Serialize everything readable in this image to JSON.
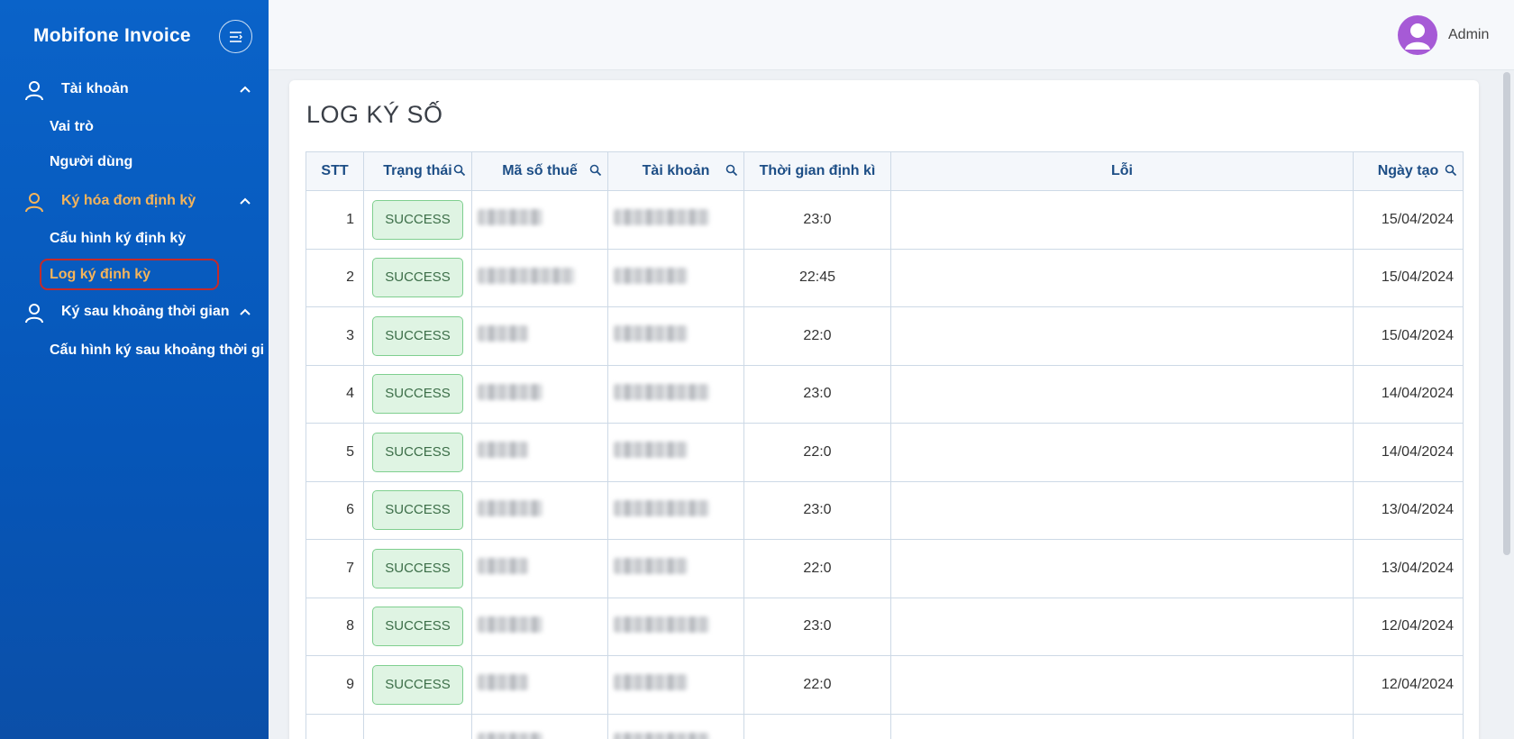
{
  "app": {
    "title": "Mobifone Invoice"
  },
  "user": {
    "name": "Admin"
  },
  "sidebar": {
    "groups": [
      {
        "label": "Tài khoản",
        "icon": "user-icon",
        "expanded": true,
        "items": [
          "Vai trò",
          "Người dùng"
        ]
      },
      {
        "label": "Ký hóa đơn định kỳ",
        "icon": "user-icon",
        "expanded": true,
        "active": true,
        "items": [
          "Cấu hình ký định kỳ",
          "Log ký định kỳ"
        ]
      },
      {
        "label": "Ký sau khoảng thời gian",
        "icon": "user-icon",
        "expanded": true,
        "items": [
          "Cấu hình ký sau khoảng thời gi"
        ]
      }
    ],
    "active_item": "Log ký định kỳ"
  },
  "main": {
    "title": "LOG KÝ SỐ",
    "columns": [
      {
        "label": "STT",
        "searchable": false
      },
      {
        "label": "Trạng thái",
        "searchable": true
      },
      {
        "label": "Mã số thuế",
        "searchable": true
      },
      {
        "label": "Tài khoản",
        "searchable": true
      },
      {
        "label": "Thời gian định kì",
        "searchable": false
      },
      {
        "label": "Lỗi",
        "searchable": false
      },
      {
        "label": "Ngày tạo",
        "searchable": true
      }
    ],
    "rows": [
      {
        "stt": "1",
        "status": "SUCCESS",
        "time": "23:0",
        "error": "",
        "date": "15/04/2024"
      },
      {
        "stt": "2",
        "status": "SUCCESS",
        "time": "22:45",
        "error": "",
        "date": "15/04/2024"
      },
      {
        "stt": "3",
        "status": "SUCCESS",
        "time": "22:0",
        "error": "",
        "date": "15/04/2024"
      },
      {
        "stt": "4",
        "status": "SUCCESS",
        "time": "23:0",
        "error": "",
        "date": "14/04/2024"
      },
      {
        "stt": "5",
        "status": "SUCCESS",
        "time": "22:0",
        "error": "",
        "date": "14/04/2024"
      },
      {
        "stt": "6",
        "status": "SUCCESS",
        "time": "23:0",
        "error": "",
        "date": "13/04/2024"
      },
      {
        "stt": "7",
        "status": "SUCCESS",
        "time": "22:0",
        "error": "",
        "date": "13/04/2024"
      },
      {
        "stt": "8",
        "status": "SUCCESS",
        "time": "23:0",
        "error": "",
        "date": "12/04/2024"
      },
      {
        "stt": "9",
        "status": "SUCCESS",
        "time": "22:0",
        "error": "",
        "date": "12/04/2024"
      },
      {
        "stt": "",
        "status": "",
        "time": "",
        "error": "",
        "date": ""
      }
    ]
  },
  "colors": {
    "sidebar_bg": "#0a63c9",
    "active_text": "#f5b45a",
    "active_outline": "#c42a2a",
    "success_bg": "#dff4e3",
    "success_border": "#7fcf8f",
    "header_text": "#1d4e86",
    "avatar_bg": "#a65ad6"
  }
}
